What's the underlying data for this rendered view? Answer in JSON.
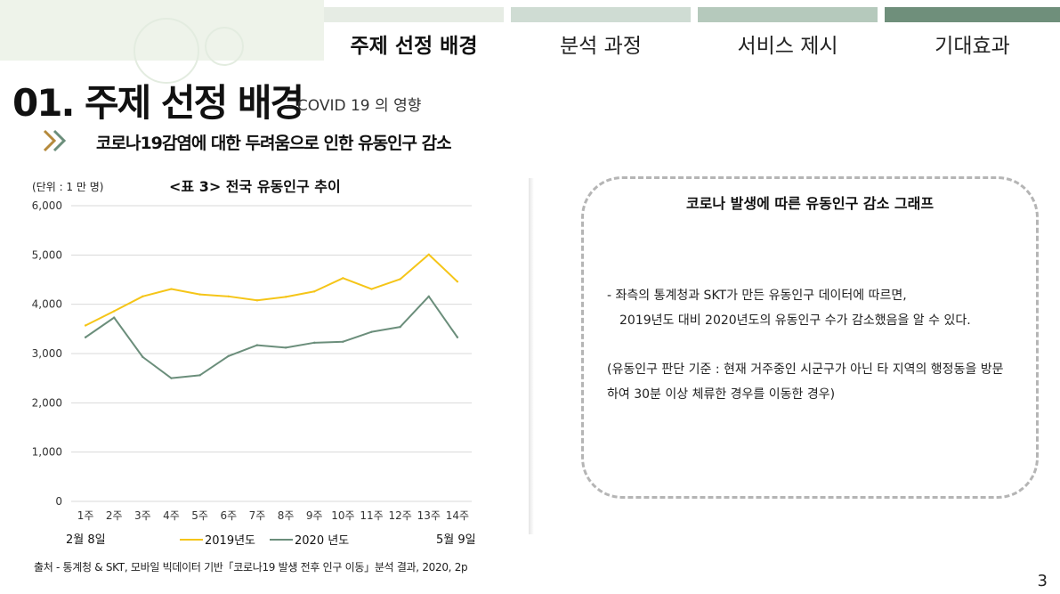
{
  "tabs": [
    {
      "label": "주제 선정 배경",
      "bar": "#e6ece4",
      "active": true
    },
    {
      "label": "분석 과정",
      "bar": "#cfdcd3",
      "active": false
    },
    {
      "label": "서비스 제시",
      "bar": "#b5c9bc",
      "active": false
    },
    {
      "label": "기대효과",
      "bar": "#6f8f7b",
      "active": false
    }
  ],
  "header": {
    "title": "01. 주제 선정 배경",
    "subtitle": "– COVID 19 의 영향",
    "sub_heading": "코로나19감염에 대한 두려움으로 인한 유동인구 감소"
  },
  "chart_data": {
    "type": "line",
    "title": "<표 3> 전국 유동인구 추이",
    "unit_label": "(단위 : 1 만 명)",
    "categories": [
      "1주",
      "2주",
      "3주",
      "4주",
      "5주",
      "6주",
      "7주",
      "8주",
      "9주",
      "10주",
      "11주",
      "12주",
      "13주",
      "14주"
    ],
    "y_ticks": [
      "0",
      "1,000",
      "2,000",
      "3,000",
      "4,000",
      "5,000",
      "6,000"
    ],
    "ylim": [
      0,
      6000
    ],
    "grid": true,
    "series": [
      {
        "name": "2019년도",
        "color": "#f5c518",
        "values": [
          3570,
          3860,
          4160,
          4310,
          4200,
          4160,
          4080,
          4150,
          4260,
          4530,
          4310,
          4510,
          5010,
          4460
        ]
      },
      {
        "name": "2020 년도",
        "color": "#6b8e7b",
        "values": [
          3330,
          3730,
          2930,
          2500,
          2560,
          2950,
          3170,
          3120,
          3220,
          3240,
          3440,
          3540,
          4160,
          3330
        ]
      }
    ],
    "date_start": "2월 8일",
    "date_end": "5월 9일",
    "legend_position": "bottom"
  },
  "source": "출처 -   통계청 & SKT, 모바일 빅데이터 기반「코로나19 발생 전후 인구 이동」분석 결과, 2020, 2p",
  "info_box": {
    "title": "코로나 발생에 따른 유동인구 감소 그래프",
    "line1": "- 좌측의 통계청과 SKT가 만든 유동인구 데이터에 따르면,",
    "line2": "2019년도 대비 2020년도의 유동인구 수가 감소했음을  알 수 있다.",
    "line3": "(유동인구 판단 기준 : 현재 거주중인 시군구가 아닌 타 지역의 행정동을 방문",
    "line4": "하여 30분 이상 체류한 경우를 이동한 경우)"
  },
  "page_number": "3",
  "colors": {
    "chevron1": "#b58a3c",
    "chevron2": "#6b8e7b",
    "grid": "#d9d9d9"
  }
}
